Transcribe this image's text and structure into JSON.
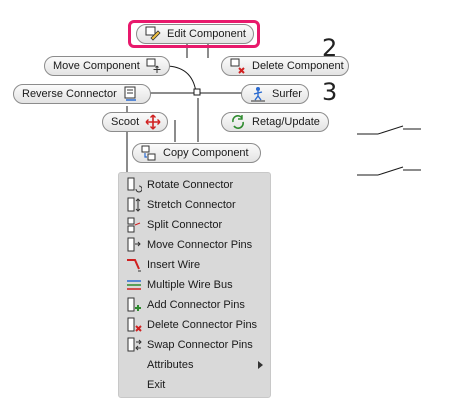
{
  "marking_menu": {
    "edit_component": "Edit Component",
    "move_component": "Move Component",
    "delete_component": "Delete Component",
    "reverse_connector": "Reverse Connector",
    "surfer": "Surfer",
    "scoot": "Scoot",
    "retag_update": "Retag/Update",
    "copy_component": "Copy Component"
  },
  "context_menu": {
    "items": [
      {
        "label": "Rotate Connector",
        "icon": "rotate-connector-icon"
      },
      {
        "label": "Stretch Connector",
        "icon": "stretch-connector-icon"
      },
      {
        "label": "Split Connector",
        "icon": "split-connector-icon"
      },
      {
        "label": "Move Connector Pins",
        "icon": "move-connector-pins-icon"
      },
      {
        "label": "Insert Wire",
        "icon": "insert-wire-icon"
      },
      {
        "label": "Multiple Wire Bus",
        "icon": "multiple-wire-bus-icon"
      },
      {
        "label": "Add Connector Pins",
        "icon": "add-connector-pins-icon"
      },
      {
        "label": "Delete Connector Pins",
        "icon": "delete-connector-pins-icon"
      },
      {
        "label": "Swap Connector Pins",
        "icon": "swap-connector-pins-icon"
      },
      {
        "label": "Attributes",
        "icon": "",
        "submenu": true
      },
      {
        "label": "Exit",
        "icon": ""
      }
    ]
  },
  "drawing": {
    "label_2": "2",
    "label_3": "3"
  },
  "colors": {
    "highlight": "#e8196c",
    "menu_background": "#d9d9d9",
    "pill_border": "#8c8c8c"
  }
}
